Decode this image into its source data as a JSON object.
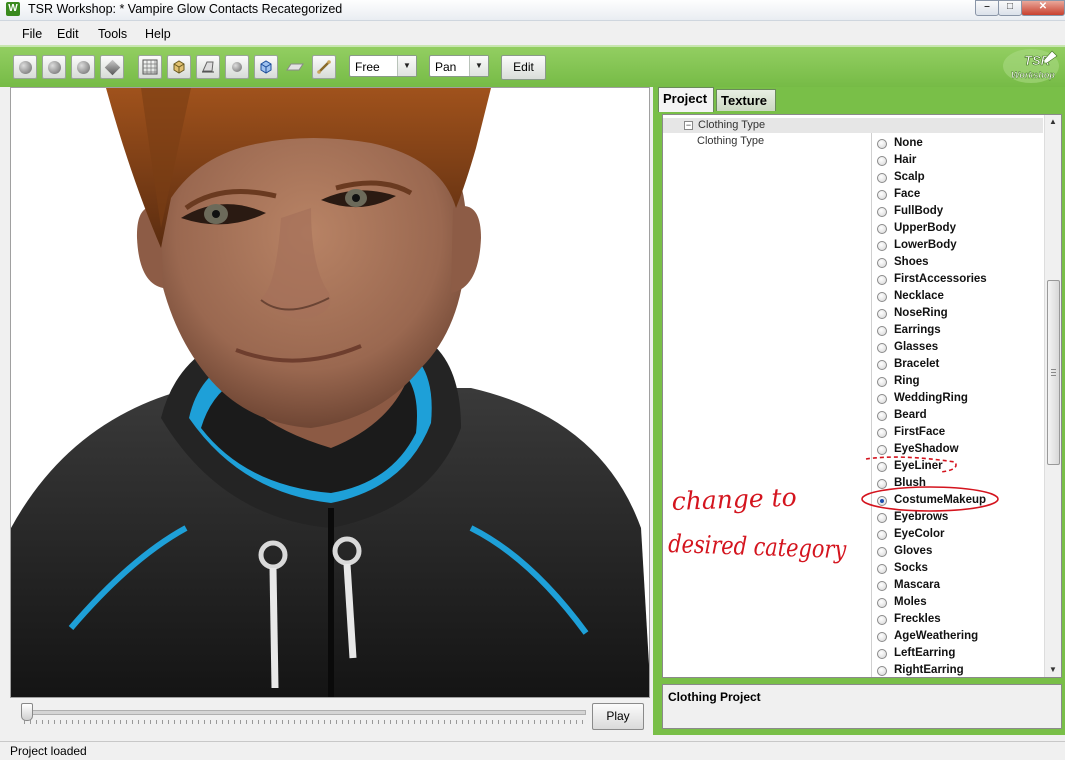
{
  "window": {
    "app_icon": "W",
    "title": "TSR Workshop: * Vampire Glow Contacts Recategorized",
    "btn_min": "–",
    "btn_max": "□",
    "btn_close": "✕"
  },
  "menu": {
    "file": "File",
    "edit": "Edit",
    "tools": "Tools",
    "help": "Help"
  },
  "toolbar": {
    "camera_mode": "Free",
    "nav_mode": "Pan",
    "edit_label": "Edit",
    "logo_line1": "TSR",
    "logo_line2": "Workshop"
  },
  "viewport": {
    "play_label": "Play",
    "timeline_position": 0
  },
  "project_panel": {
    "tab_project": "Project",
    "tab_texture": "Texture",
    "category": "Clothing Type",
    "category_toggle": "−",
    "property_name": "Clothing Type",
    "options": [
      "None",
      "Hair",
      "Scalp",
      "Face",
      "FullBody",
      "UpperBody",
      "LowerBody",
      "Shoes",
      "FirstAccessories",
      "Necklace",
      "NoseRing",
      "Earrings",
      "Glasses",
      "Bracelet",
      "Ring",
      "WeddingRing",
      "Beard",
      "FirstFace",
      "EyeShadow",
      "EyeLiner",
      "Blush",
      "CostumeMakeup",
      "Eyebrows",
      "EyeColor",
      "Gloves",
      "Socks",
      "Mascara",
      "Moles",
      "Freckles",
      "AgeWeathering",
      "LeftEarring",
      "RightEarring"
    ],
    "selected": "CostumeMakeup",
    "description_title": "Clothing Project"
  },
  "annotation": {
    "line1": "change to",
    "line2": "desired category",
    "color": "#d4141e"
  },
  "status": {
    "text": "Project loaded"
  }
}
